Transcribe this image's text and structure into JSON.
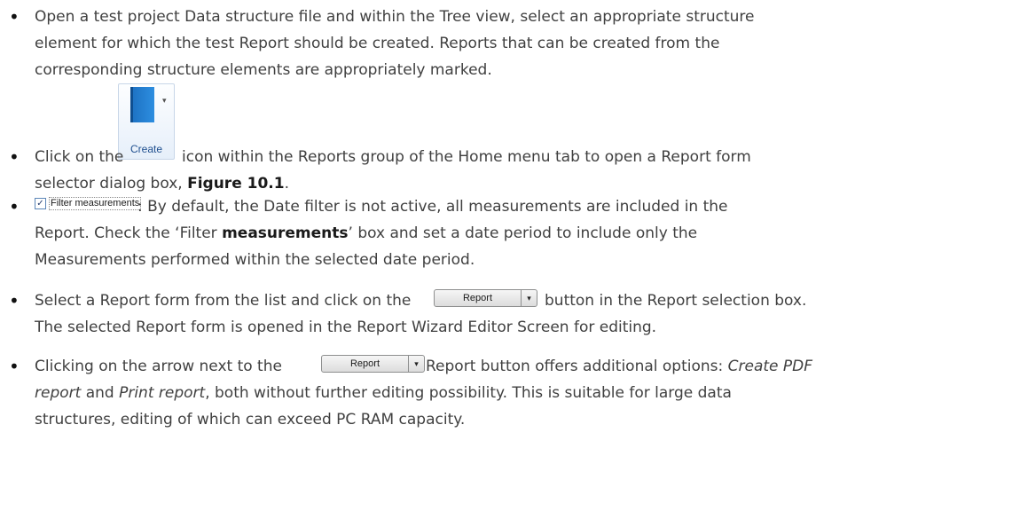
{
  "bullets": {
    "b1": {
      "line1": "Open a test project Data structure file and within the Tree view, select an appropriate structure",
      "line2": "element for which the test Report should be created. Reports that can be created from the",
      "line3": "corresponding structure elements are appropriately marked."
    },
    "b2": {
      "pre": "Click on the",
      "post": "icon within the Reports group of the Home menu tab to open a Report form",
      "line2_pre": "selector dialog box, ",
      "figure_ref": "Figure 10.1",
      "line2_post": "."
    },
    "b3": {
      "post": ": By default, the Date filter is not active, all measurements are included in the",
      "line2": "Report. Check the ‘Filter ",
      "line2_bold": "measurements",
      "line2_end": "’ box and set a date period to include only the",
      "line3": "Measurements performed within the selected date period."
    },
    "b4": {
      "pre": "Select a Report form from the list and click on the",
      "post": "button in the Report selection box.",
      "line2": "The selected Report form is opened in the Report Wizard Editor Screen for editing."
    },
    "b5": {
      "pre": "Clicking on the arrow next to the",
      "post": "Report button offers additional options: ",
      "opt1": "Create PDF",
      "opt1b": "report",
      "mid": " and ",
      "opt2": "Print report",
      "line2_post": ", both without further editing possibility. This is suitable for large data",
      "line3": "structures, editing of which can exceed PC RAM capacity."
    }
  },
  "icons": {
    "create_label": "Create",
    "filter_label": "Filter measurements",
    "filter_checked": true,
    "report_label": "Report",
    "dropdown_glyph": "▾",
    "check_glyph": "✓"
  },
  "colors": {
    "text": "#404040",
    "create_blue": "#1e73c4"
  }
}
